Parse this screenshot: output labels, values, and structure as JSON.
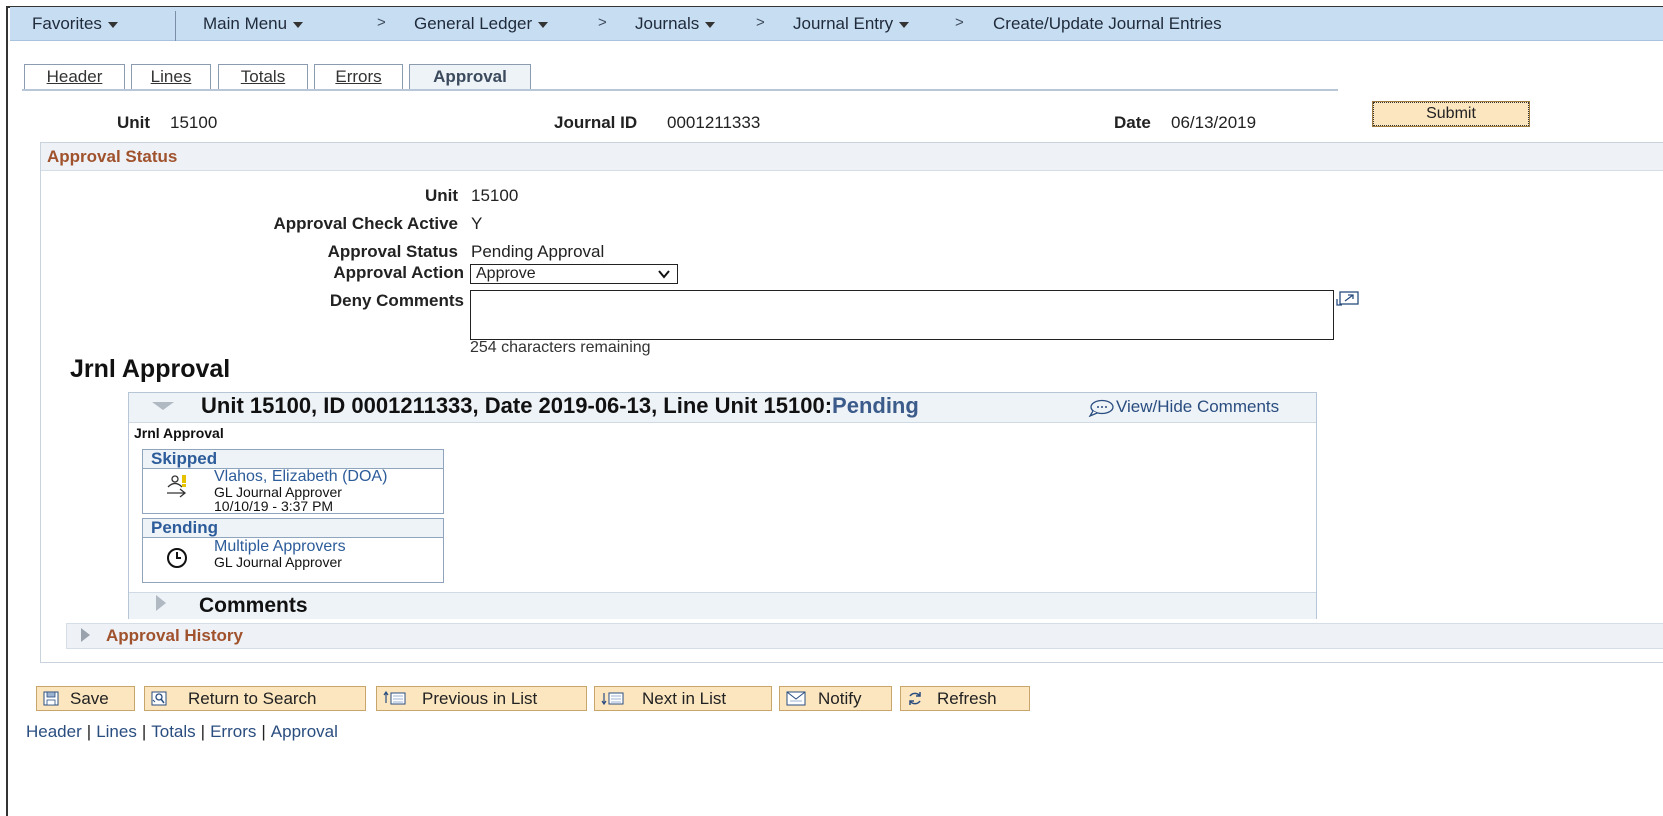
{
  "nav": {
    "favorites": "Favorites",
    "main_menu": "Main Menu",
    "general_ledger": "General Ledger",
    "journals": "Journals",
    "journal_entry": "Journal Entry",
    "page": "Create/Update Journal Entries",
    "separator": ">"
  },
  "tabs": {
    "header": "Header",
    "lines": "Lines",
    "totals": "Totals",
    "errors": "Errors",
    "approval": "Approval"
  },
  "page_header": {
    "unit_label": "Unit",
    "unit_value": "15100",
    "journal_id_label": "Journal ID",
    "journal_id_value": "0001211333",
    "date_label": "Date",
    "date_value": "06/13/2019",
    "submit_label": "Submit"
  },
  "approval_status": {
    "title": "Approval Status",
    "unit_label": "Unit",
    "unit_value": "15100",
    "check_active_label": "Approval Check Active",
    "check_active_value": "Y",
    "status_label": "Approval Status",
    "status_value": "Pending Approval",
    "action_label": "Approval Action",
    "action_value": "Approve",
    "deny_label": "Deny Comments",
    "deny_value": "",
    "remaining": "254 characters remaining"
  },
  "jrnl_approval": {
    "title": "Jrnl Approval",
    "header_text": "Unit 15100, ID 0001211333, Date 2019-06-13, Line Unit 15100:",
    "header_status": "Pending",
    "view_hide": "View/Hide Comments",
    "subtitle": "Jrnl Approval",
    "steps": [
      {
        "status": "Skipped",
        "name": "Vlahos, Elizabeth (DOA)",
        "role": "GL Journal Approver",
        "timestamp": "10/10/19 - 3:37 PM",
        "icon": "skipped-user-icon"
      },
      {
        "status": "Pending",
        "name": "Multiple Approvers",
        "role": "GL Journal Approver",
        "icon": "clock-icon"
      }
    ],
    "comments_title": "Comments"
  },
  "approval_history": {
    "title": "Approval History"
  },
  "toolbar": {
    "save": "Save",
    "return_to_search": "Return to Search",
    "previous_in_list": "Previous in List",
    "next_in_list": "Next in List",
    "notify": "Notify",
    "refresh": "Refresh"
  },
  "footer_links": {
    "header": "Header",
    "lines": "Lines",
    "totals": "Totals",
    "errors": "Errors",
    "approval": "Approval",
    "separator": "|"
  },
  "colors": {
    "nav_bg": "#c7ddf2",
    "section_title": "#a0522d",
    "link": "#2a4d80",
    "button_bg": "#fbe6c0"
  }
}
